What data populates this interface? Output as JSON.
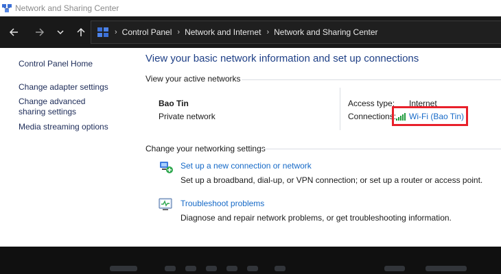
{
  "window": {
    "title": "Network and Sharing Center",
    "app_icon": "network-sharing-icon"
  },
  "toolbar": {
    "back_icon": "arrow-left-icon",
    "forward_icon": "arrow-right-icon",
    "recent_icon": "chevron-down-icon",
    "up_icon": "arrow-up-icon"
  },
  "address": {
    "icon": "control-panel-icon",
    "crumbs": [
      "Control Panel",
      "Network and Internet",
      "Network and Sharing Center"
    ]
  },
  "sidebar": {
    "home": "Control Panel Home",
    "items": [
      {
        "label": "Change adapter settings"
      },
      {
        "label": "Change advanced sharing settings"
      },
      {
        "label": "Media streaming options"
      }
    ]
  },
  "main": {
    "heading": "View your basic network information and set up connections",
    "active_networks_label": "View your active networks",
    "network": {
      "name": "Bao Tin",
      "type": "Private network",
      "access_type_label": "Access type:",
      "access_type_value": "Internet",
      "connections_label": "Connections:",
      "connection_link": "Wi-Fi (Bao Tin)",
      "connection_icon": "wifi-signal-icon"
    },
    "change_settings_label": "Change your networking settings",
    "tasks": [
      {
        "icon": "new-connection-icon",
        "title": "Set up a new connection or network",
        "description": "Set up a broadband, dial-up, or VPN connection; or set up a router or access point."
      },
      {
        "icon": "troubleshoot-icon",
        "title": "Troubleshoot problems",
        "description": "Diagnose and repair network problems, or get troubleshooting information."
      }
    ]
  },
  "colors": {
    "link": "#1569c7",
    "heading": "#1e3f86",
    "highlight": "#e8202a"
  }
}
